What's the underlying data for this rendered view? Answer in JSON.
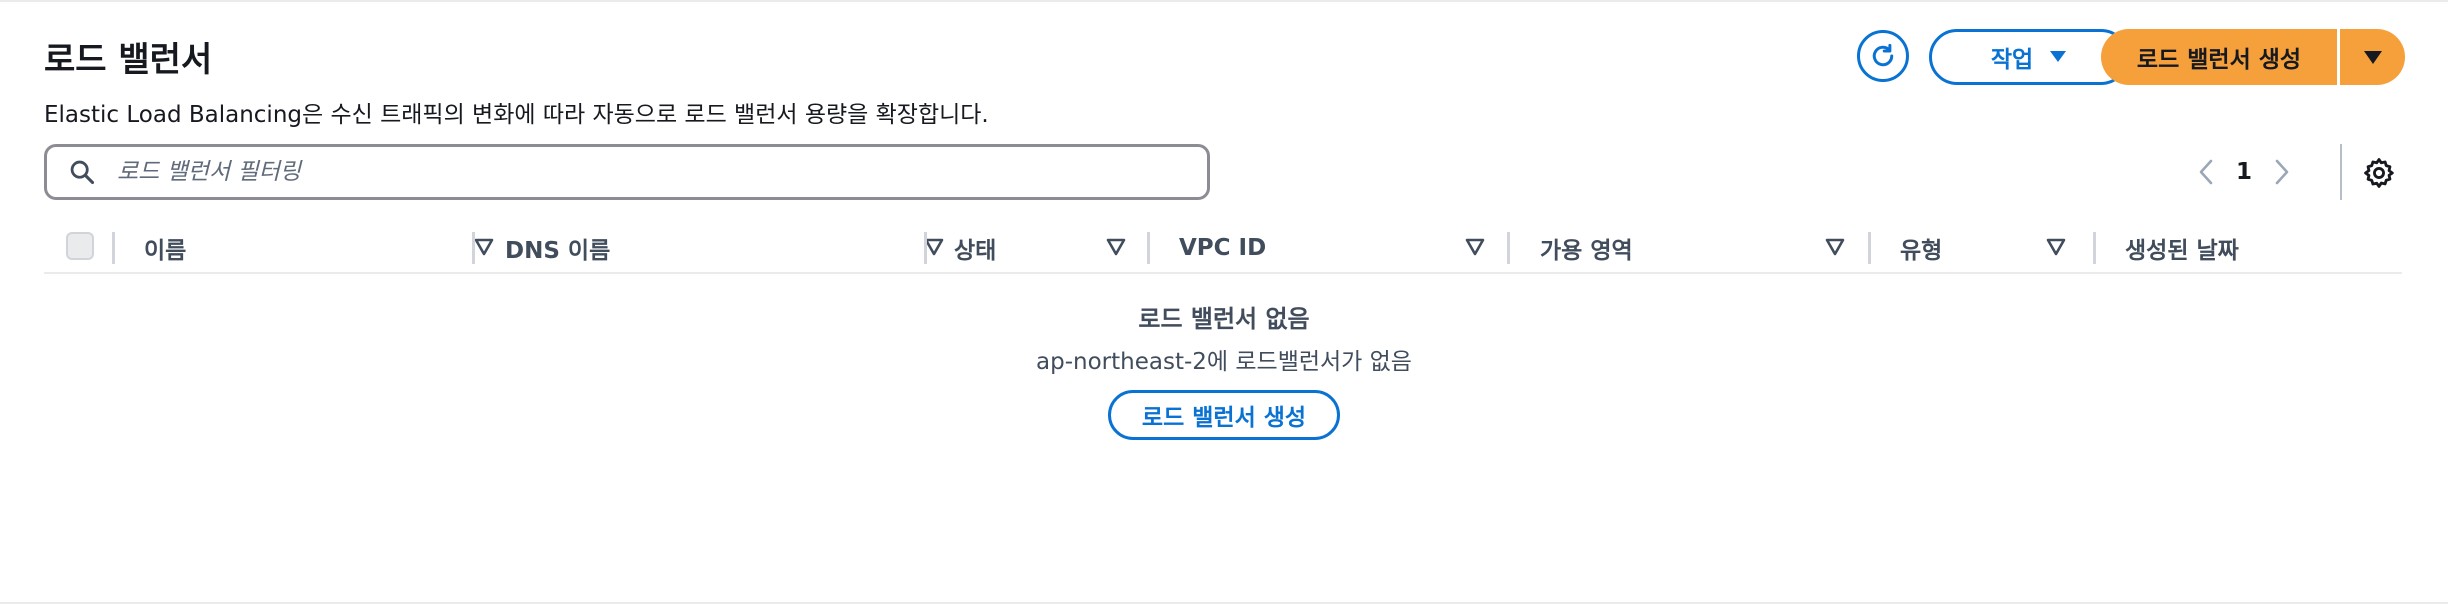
{
  "header": {
    "title": "로드 밸런서",
    "description": "Elastic Load Balancing은 수신 트래픽의 변화에 따라 자동으로 로드 밸런서 용량을 확장합니다.",
    "refresh_icon": "refresh-icon",
    "actions_label": "작업",
    "create_label": "로드 밸런서 생성"
  },
  "search": {
    "placeholder": "로드 밸런서 필터링",
    "value": ""
  },
  "pagination": {
    "current_page": "1"
  },
  "table": {
    "columns": [
      "이름",
      "DNS 이름",
      "상태",
      "VPC ID",
      "가용 영역",
      "유형",
      "생성된 날짜"
    ]
  },
  "empty_state": {
    "title": "로드 밸런서 없음",
    "message": "ap-northeast-2에 로드밸런서가 없음",
    "button_label": "로드 밸런서 생성"
  },
  "colors": {
    "accent": "#0972d3",
    "primary_button": "#f5a03a"
  }
}
